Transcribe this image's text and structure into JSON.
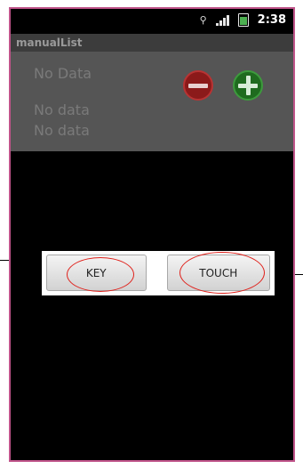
{
  "status_bar": {
    "icons": [
      "usb-debug-icon",
      "signal-icon",
      "battery-icon"
    ],
    "time": "2:38"
  },
  "app": {
    "title": "manualList",
    "rows": [
      "No Data",
      "No data",
      "No data"
    ],
    "buttons": {
      "remove_icon": "minus-circle-icon",
      "add_icon": "plus-circle-icon"
    }
  },
  "dialog": {
    "buttons": [
      {
        "label": "KEY"
      },
      {
        "label": "TOUCH"
      }
    ]
  },
  "colors": {
    "frame_border": "#c0548a",
    "annotation": "#e0201a",
    "remove": "#8b1a1a",
    "add": "#1f6b1f"
  }
}
